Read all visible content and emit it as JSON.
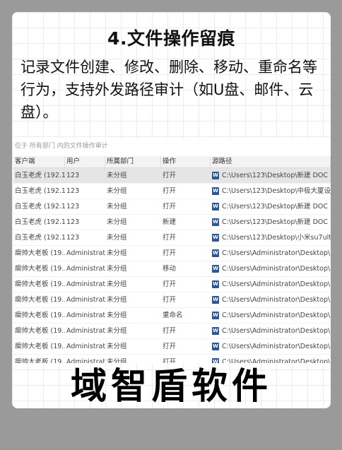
{
  "title": "4.文件操作留痕",
  "description": "记录文件创建、修改、删除、移动、重命名等行为，支持外发路径审计（如U盘、邮件、云盘）。",
  "screenshot": {
    "breadcrumb": "位于 所有部门 内的文件操作审计",
    "columns": [
      "客户端",
      "用户",
      "所属部门",
      "操作",
      "源路径"
    ],
    "rows": [
      {
        "client": "白玉老虎 (192.1...",
        "user": "123",
        "dept": "未分组",
        "op": "打开",
        "path": "C:\\Users\\123\\Desktop\\新建 DOC ..."
      },
      {
        "client": "白玉老虎 (192.1...",
        "user": "123",
        "dept": "未分组",
        "op": "打开",
        "path": "C:\\Users\\123\\Desktop\\中极大厦设..."
      },
      {
        "client": "白玉老虎 (192.1...",
        "user": "123",
        "dept": "未分组",
        "op": "打开",
        "path": "C:\\Users\\123\\Desktop\\新建 DOC ..."
      },
      {
        "client": "白玉老虎 (192.1...",
        "user": "123",
        "dept": "未分组",
        "op": "新建",
        "path": "C:\\Users\\123\\Desktop\\新建 DOC ..."
      },
      {
        "client": "白玉老虎 (192.1...",
        "user": "123",
        "dept": "未分组",
        "op": "打开",
        "path": "C:\\Users\\123\\Desktop\\小米su7ultr..."
      },
      {
        "client": "瘸帅大老板 (19...",
        "user": "Administrat...",
        "dept": "未分组",
        "op": "打开",
        "path": "C:\\Users\\Administrator\\Desktop\\..."
      },
      {
        "client": "瘸帅大老板 (19...",
        "user": "Administrat...",
        "dept": "未分组",
        "op": "移动",
        "path": "C:\\Users\\Administrator\\Desktop\\..."
      },
      {
        "client": "瘸帅大老板 (19...",
        "user": "Administrat...",
        "dept": "未分组",
        "op": "打开",
        "path": "C:\\Users\\Administrator\\Desktop\\..."
      },
      {
        "client": "瘸帅大老板 (19...",
        "user": "Administrat...",
        "dept": "未分组",
        "op": "打开",
        "path": "C:\\Users\\Administrator\\Desktop\\..."
      },
      {
        "client": "瘸帅大老板 (19...",
        "user": "Administrat...",
        "dept": "未分组",
        "op": "重命名",
        "path": "C:\\Users\\Administrator\\Desktop\\..."
      },
      {
        "client": "瘸帅大老板 (19...",
        "user": "Administrat...",
        "dept": "未分组",
        "op": "打开",
        "path": "C:\\Users\\Administrator\\Desktop\\..."
      },
      {
        "client": "瘸帅大老板 (19...",
        "user": "Administrat...",
        "dept": "未分组",
        "op": "打开",
        "path": "C:\\Users\\Administrator\\Desktop\\..."
      },
      {
        "client": "瘸帅大老板 (19...",
        "user": "Administrat...",
        "dept": "未分组",
        "op": "打开",
        "path": "C:\\Users\\Administrator\\Desktop\\..."
      }
    ],
    "file_icon": "word-document-icon",
    "file_icon_glyph": "W",
    "selected_row": 0
  },
  "brand": "域智盾软件"
}
